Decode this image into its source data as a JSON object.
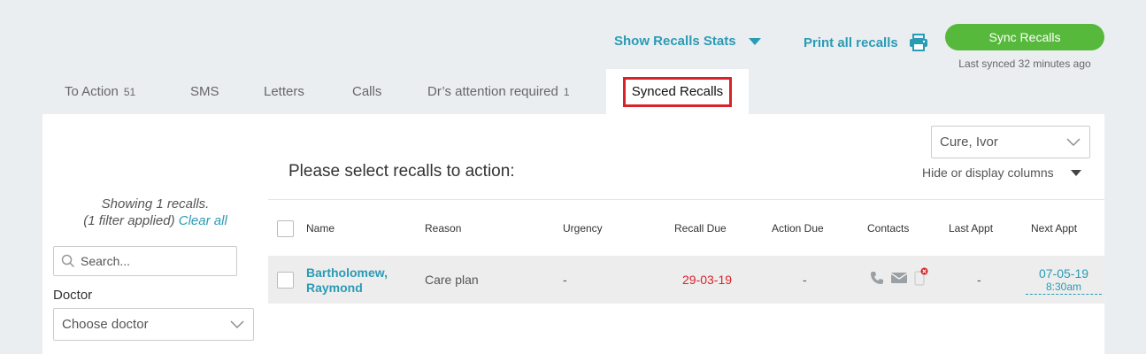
{
  "header": {
    "show_stats_label": "Show Recalls Stats",
    "print_label": "Print all recalls",
    "sync_label": "Sync Recalls",
    "last_synced": "Last synced 32 minutes ago"
  },
  "tabs": [
    {
      "label": "To Action",
      "count": "51"
    },
    {
      "label": "SMS",
      "count": ""
    },
    {
      "label": "Letters",
      "count": ""
    },
    {
      "label": "Calls",
      "count": ""
    },
    {
      "label": "Dr’s attention required",
      "count": "1"
    },
    {
      "label": "Synced Recalls",
      "count": "",
      "active": true
    }
  ],
  "sidebar": {
    "showing": "Showing 1 recalls.",
    "filter_applied": "(1 filter applied)",
    "clear_all": "Clear all",
    "search_placeholder": "Search...",
    "doctor_label": "Doctor",
    "doctor_placeholder": "Choose doctor"
  },
  "main": {
    "heading": "Please select recalls to action:",
    "user_filter": "Cure, Ivor",
    "columns_toggle": "Hide or display columns"
  },
  "table": {
    "columns": [
      "Name",
      "Reason",
      "Urgency",
      "Recall Due",
      "Action Due",
      "Contacts",
      "Last Appt",
      "Next Appt"
    ],
    "rows": [
      {
        "name_line1": "Bartholomew,",
        "name_line2": "Raymond",
        "reason": "Care plan",
        "urgency": "-",
        "recall_due": "29-03-19",
        "action_due": "-",
        "last_appt": "-",
        "next_appt_date": "07-05-19",
        "next_appt_time": "8:30am"
      }
    ]
  },
  "colors": {
    "accent": "#2a9bb5",
    "sync_green": "#57b93b",
    "due_red": "#d8232a",
    "highlight_red": "#d8232a"
  },
  "icons": [
    "caret-down-icon",
    "printer-icon",
    "search-icon",
    "chevron-down-icon",
    "phone-icon",
    "mail-icon",
    "sms-blocked-icon"
  ]
}
